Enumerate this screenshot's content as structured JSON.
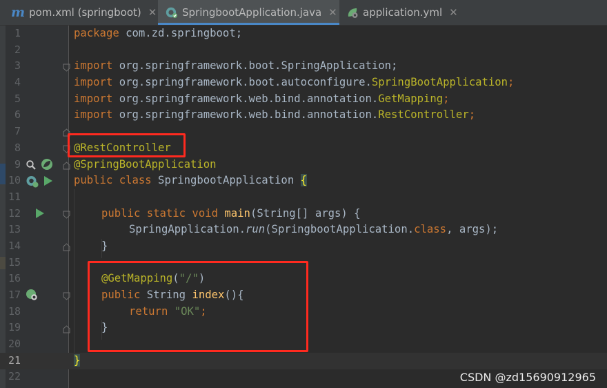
{
  "tabs": [
    {
      "label": "pom.xml (springboot)",
      "icon": "maven-icon",
      "active": false
    },
    {
      "label": "SpringbootApplication.java",
      "icon": "spring-boot-class-icon",
      "active": true
    },
    {
      "label": "application.yml",
      "icon": "spring-config-icon",
      "active": false
    }
  ],
  "editor": {
    "current_line": 21,
    "line_numbers": [
      "1",
      "2",
      "3",
      "4",
      "5",
      "6",
      "7",
      "8",
      "9",
      "10",
      "11",
      "12",
      "13",
      "14",
      "15",
      "16",
      "17",
      "18",
      "19",
      "20",
      "21",
      "22"
    ],
    "code": {
      "l1_kw": "package",
      "l1_rest": " com.zd.springboot;",
      "import_kw": "import",
      "l3_path": " org.springframework.boot.SpringApplication;",
      "l4_path": " org.springframework.boot.autoconfigure.",
      "l4_ann": "SpringBootApplication",
      "l5_path": " org.springframework.web.bind.annotation.",
      "l5_ann": "GetMapping",
      "l6_path": " org.springframework.web.bind.annotation.",
      "l6_ann": "RestController",
      "semicolon": ";",
      "l8_ann": "@RestController",
      "l9_ann": "@SpringBootApplication",
      "l10_kw": "public class",
      "l10_name": " SpringbootApplication ",
      "l10_brace": "{",
      "l12_kw": "public static void",
      "l12_fn": "main",
      "l12_rest": "(String[] args) {",
      "l13_pre": "SpringApplication.",
      "l13_run": "run",
      "l13_mid": "(SpringbootApplication.",
      "l13_class": "class",
      "l13_end": ", args);",
      "close_brace": "}",
      "l16_ann": "@GetMapping",
      "l16_open": "(",
      "l16_str": "\"/\"",
      "l16_close": ")",
      "l17_kw": "public",
      "l17_type": " String ",
      "l17_fn": "index",
      "l17_rest": "(){",
      "l18_kw": "return",
      "l18_str": "\"OK\"",
      "l21_brace": "}"
    }
  },
  "colors": {
    "keyword": "#cc7832",
    "annotation": "#bbb529",
    "string": "#6a8759",
    "method": "#ffc66d",
    "text": "#a9b7c6",
    "highlight_box": "#ff2a1f"
  },
  "watermark": "CSDN @zd15690912965"
}
